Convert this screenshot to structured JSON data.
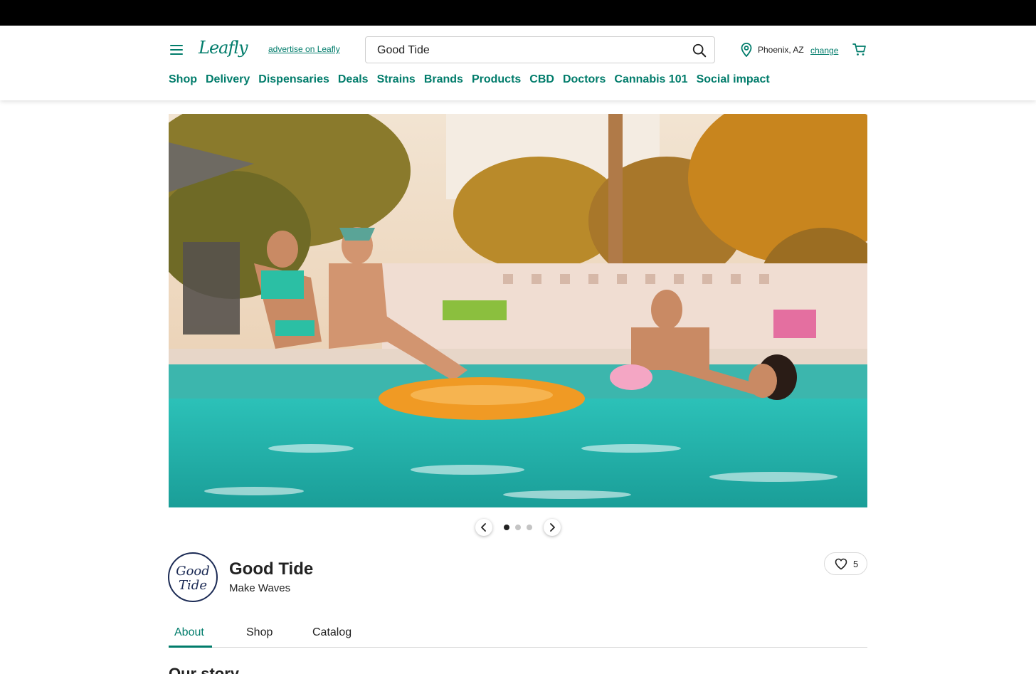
{
  "header": {
    "logo": "Leafly",
    "advertise_link": "advertise on Leafly",
    "search_value": "Good Tide",
    "location": "Phoenix, AZ",
    "location_change": "change",
    "accent_color": "#017c6b"
  },
  "nav": {
    "items": [
      "Shop",
      "Delivery",
      "Dispensaries",
      "Deals",
      "Strains",
      "Brands",
      "Products",
      "CBD",
      "Doctors",
      "Cannabis 101",
      "Social impact"
    ]
  },
  "hero": {
    "carousel_dots": 3,
    "active_index": 0
  },
  "brand": {
    "name": "Good Tide",
    "tagline": "Make Waves",
    "logo_text_line1": "Good",
    "logo_text_line2": "Tide",
    "favorites_count": "5"
  },
  "tabs": {
    "items": [
      "About",
      "Shop",
      "Catalog"
    ],
    "active": "About"
  },
  "section": {
    "heading": "Our story"
  }
}
